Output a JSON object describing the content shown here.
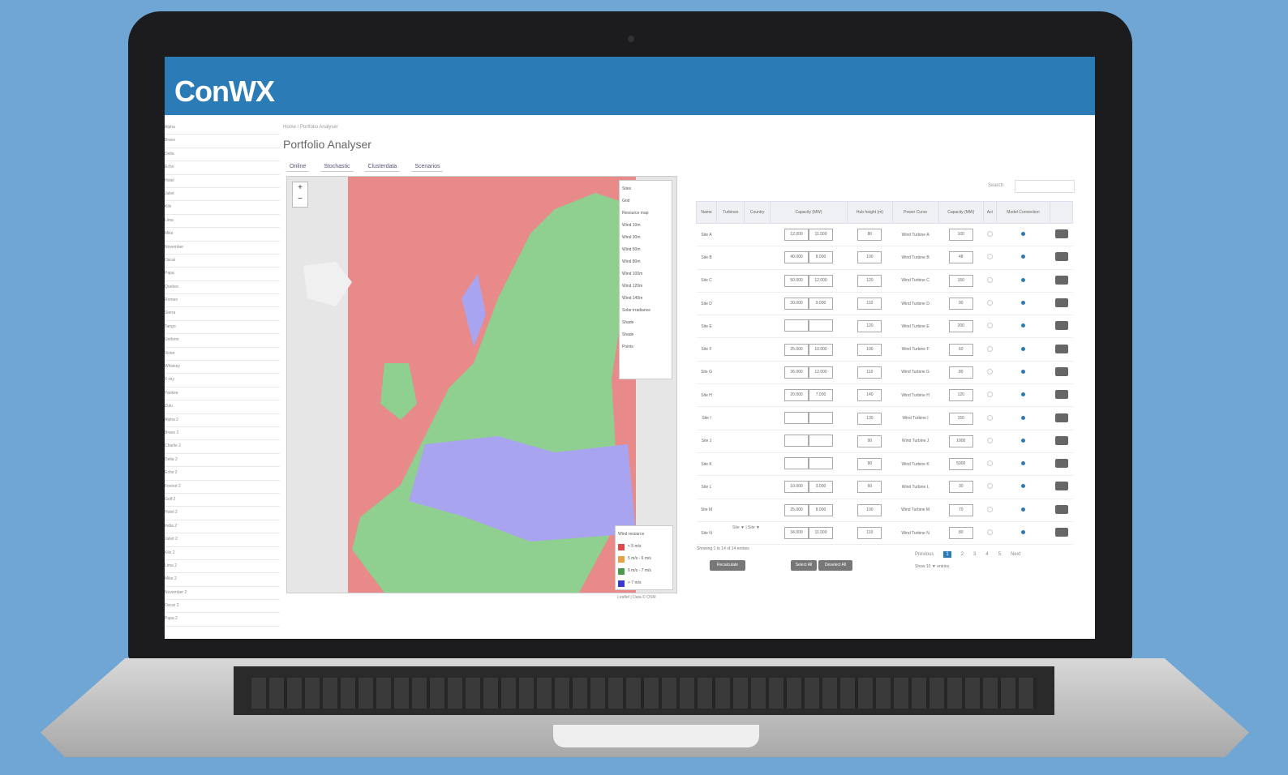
{
  "app": {
    "logo": "ConWX"
  },
  "sidebar": {
    "items": [
      "Alpha",
      "Bravo",
      "Delta",
      "Echo",
      "Hotel",
      "Juliet",
      "Kilo",
      "Lima",
      "Mike",
      "November",
      "Oscar",
      "Papa",
      "Quebec",
      "Romeo",
      "Sierra",
      "Tango",
      "Uniform",
      "Victor",
      "Whiskey",
      "X-ray",
      "Yankee",
      "Zulu",
      "Alpha 2",
      "Bravo 2",
      "Charlie 2",
      "Delta 2",
      "Echo 2",
      "Foxtrot 2",
      "Golf 2",
      "Hotel 2",
      "India 2",
      "Juliet 2",
      "Kilo 2",
      "Lima 2",
      "Mike 2",
      "November 2",
      "Oscar 2",
      "Papa 2"
    ]
  },
  "breadcrumb": "Home / Portfolio Analyser",
  "page_title": "Portfolio Analyser",
  "tabs": [
    "Online",
    "Stochastic",
    "Clusterdata",
    "Scenarios"
  ],
  "map": {
    "zoom_in": "+",
    "zoom_out": "−",
    "layers": [
      "Sites",
      "Grid",
      "Resource map",
      "Wind 10m",
      "Wind 30m",
      "Wind 50m",
      "Wind 80m",
      "Wind 100m",
      "Wind 120m",
      "Wind 140m",
      "Solar irradiance",
      "Shade",
      "Shade",
      "Points"
    ],
    "legend_title": "Wind resource",
    "legend": [
      {
        "label": "< 5 m/s",
        "color": "#d94c4c"
      },
      {
        "label": "5 m/s - 6 m/s",
        "color": "#e8a04c"
      },
      {
        "label": "6 m/s - 7 m/s",
        "color": "#4b9a4b"
      },
      {
        "label": "> 7 m/s",
        "color": "#3a3acc"
      }
    ],
    "attribution": "Leaflet | Data © OSM"
  },
  "table": {
    "search_label": "Search:",
    "headers": [
      "Name",
      "Turbines",
      "Country",
      "Capacity (MW)",
      "Hub height (m)",
      "Power Curve",
      "Capacity (MW)",
      "Act",
      "Model Connection",
      ""
    ],
    "rows": [
      {
        "name": "Site A",
        "cap": [
          "12.000",
          "11.000"
        ],
        "hub": "80",
        "curve": "Wind Turbine A",
        "mw": "100"
      },
      {
        "name": "Site B",
        "cap": [
          "40.000",
          "8.000"
        ],
        "hub": "100",
        "curve": "Wind Turbine B",
        "mw": "48"
      },
      {
        "name": "Site C",
        "cap": [
          "50.000",
          "12.000"
        ],
        "hub": "120",
        "curve": "Wind Turbine C",
        "mw": "150"
      },
      {
        "name": "Site D",
        "cap": [
          "30.000",
          "9.000"
        ],
        "hub": "110",
        "curve": "Wind Turbine D",
        "mw": "90"
      },
      {
        "name": "Site E",
        "cap": [
          "",
          ""
        ],
        "hub": "120",
        "curve": "Wind Turbine E",
        "mw": "200"
      },
      {
        "name": "Site F",
        "cap": [
          "25.000",
          "10.000"
        ],
        "hub": "100",
        "curve": "Wind Turbine F",
        "mw": "60"
      },
      {
        "name": "Site G",
        "cap": [
          "36.000",
          "12.000"
        ],
        "hub": "110",
        "curve": "Wind Turbine G",
        "mw": "80"
      },
      {
        "name": "Site H",
        "cap": [
          "20.000",
          "7.000"
        ],
        "hub": "140",
        "curve": "Wind Turbine H",
        "mw": "120"
      },
      {
        "name": "Site I",
        "cap": [
          "",
          ""
        ],
        "hub": "130",
        "curve": "Wind Turbine I",
        "mw": "150"
      },
      {
        "name": "Site J",
        "cap": [
          "",
          ""
        ],
        "hub": "90",
        "curve": "Wind Turbine J",
        "mw": "1000"
      },
      {
        "name": "Site K",
        "cap": [
          "",
          ""
        ],
        "hub": "80",
        "curve": "Wind Turbine K",
        "mw": "5000"
      },
      {
        "name": "Site L",
        "cap": [
          "10.000",
          "3.000"
        ],
        "hub": "60",
        "curve": "Wind Turbine L",
        "mw": "30"
      },
      {
        "name": "Site M",
        "cap": [
          "25.000",
          "8.000"
        ],
        "hub": "100",
        "curve": "Wind Turbine M",
        "mw": "70"
      },
      {
        "name": "Site N",
        "cap": [
          "34.000",
          "11.000"
        ],
        "hub": "110",
        "curve": "Wind Turbine N",
        "mw": "80"
      }
    ],
    "footer": "Site ▼  |  Site ▼",
    "info": "Showing 1 to 14 of 14 entries",
    "btn_recalc": "Recalculate",
    "btn_select": "Select All",
    "btn_deselect": "Deselect All",
    "pager": [
      "Previous",
      "1",
      "2",
      "3",
      "4",
      "5",
      "Next"
    ],
    "perpage": "Show 10 ▼ entries"
  }
}
